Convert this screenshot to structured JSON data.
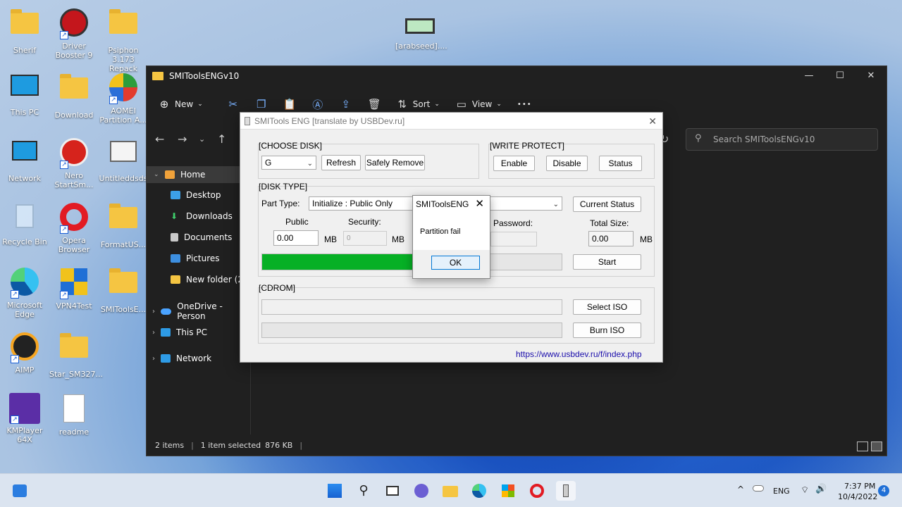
{
  "desktop": {
    "icons": [
      {
        "label": "Sherif"
      },
      {
        "label": "Driver Booster 9"
      },
      {
        "label": "Psiphon 3.173 Repack"
      },
      {
        "label": "[arabseed]...."
      },
      {
        "label": "This PC"
      },
      {
        "label": "Download"
      },
      {
        "label": "AOMEI Partition A..."
      },
      {
        "label": "Network"
      },
      {
        "label": "Nero StartSm..."
      },
      {
        "label": "Untitleddsds"
      },
      {
        "label": "Recycle Bin"
      },
      {
        "label": "Opera Browser"
      },
      {
        "label": "FormatUS..."
      },
      {
        "label": "Microsoft Edge"
      },
      {
        "label": "VPN4Test"
      },
      {
        "label": "SMIToolsE..."
      },
      {
        "label": "AIMP"
      },
      {
        "label": "Star_SM327..."
      },
      {
        "label": "KMPlayer 64X"
      },
      {
        "label": "readme"
      }
    ]
  },
  "explorer": {
    "title": "SMIToolsENGv10",
    "toolbar": {
      "new_label": "New",
      "sort_label": "Sort",
      "view_label": "View",
      "more_label": "•••"
    },
    "search_placeholder": "Search SMIToolsENGv10",
    "sidebar": {
      "home": "Home",
      "desktop": "Desktop",
      "downloads": "Downloads",
      "documents": "Documents",
      "pictures": "Pictures",
      "new_folder": "New folder (2)",
      "onedrive": "OneDrive - Person",
      "this_pc": "This PC",
      "network": "Network"
    },
    "status": {
      "items": "2 items",
      "selected": "1 item selected",
      "size": "876 KB"
    }
  },
  "smi": {
    "title": "SMITools ENG [translate by USBDev.ru]",
    "choose_disk": {
      "label": "[CHOOSE DISK]",
      "disk_value": "G",
      "refresh": "Refresh",
      "safely_remove": "Safely Remove"
    },
    "write_protect": {
      "label": "[WRITE PROTECT]",
      "enable": "Enable",
      "disable": "Disable",
      "status": "Status"
    },
    "disk_type": {
      "label": "[DISK TYPE]",
      "part_type_label": "Part Type:",
      "part_type_value": "Initialize : Public Only",
      "current_status": "Current Status",
      "public_label": "Public",
      "public_value": "0.00",
      "public_unit": "MB",
      "security_label": "Security:",
      "security_value": "0",
      "security_unit": "MB",
      "password_label": "Password:",
      "total_size_label": "Total Size:",
      "total_size_value": "0.00",
      "total_unit": "MB",
      "progress_percent": 51,
      "start": "Start"
    },
    "cdrom": {
      "label": "[CDROM]",
      "select_iso": "Select ISO",
      "burn_iso": "Burn ISO"
    },
    "link": "https://www.usbdev.ru/f/index.php"
  },
  "msgbox": {
    "title": "SMIToolsENG",
    "message": "Partition fail",
    "ok": "OK"
  },
  "taskbar": {
    "language": "ENG",
    "time": "7:37 PM",
    "date": "10/4/2022",
    "notifications": "4"
  }
}
